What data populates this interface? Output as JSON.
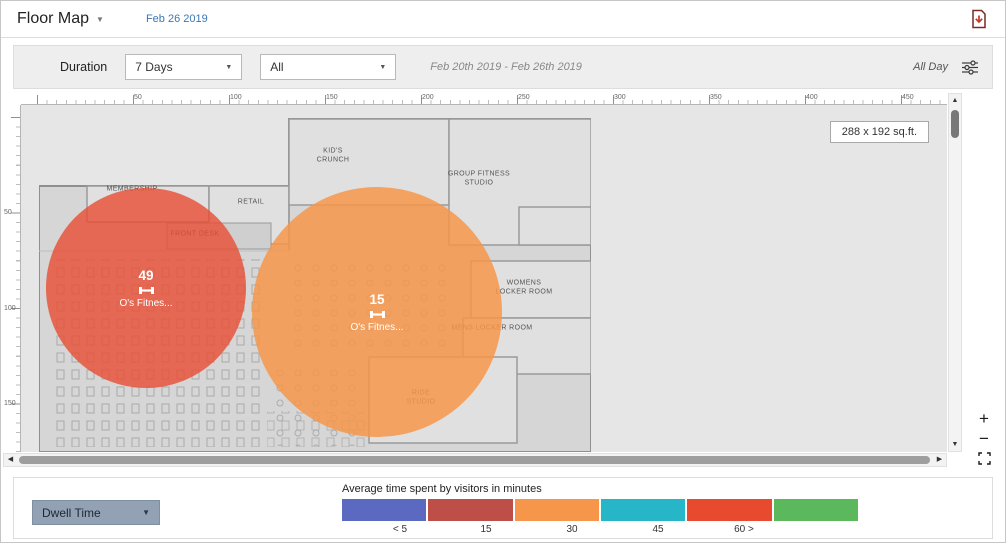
{
  "header": {
    "title": "Floor Map",
    "date": "Feb 26 2019"
  },
  "toolbar": {
    "duration_label": "Duration",
    "duration_value": "7 Days",
    "zone_value": "All",
    "date_range": "Feb 20th 2019 - Feb 26th 2019",
    "time_filter": "All Day"
  },
  "map": {
    "size_label": "288 x 192 sq.ft.",
    "ruler_x": [
      "50",
      "100",
      "150",
      "200",
      "250",
      "300",
      "350",
      "400",
      "450"
    ],
    "ruler_y": [
      "50",
      "100",
      "150"
    ],
    "rooms": [
      "MEMBERSHIP",
      "RETAIL",
      "FRONT DESK",
      "KID'S\nCRUNCH",
      "GROUP FITNESS\nSTUDIO",
      "WOMENS LOCKER ROOM",
      "MENS LOCKER ROOM",
      "RIDE\nSTUDIO"
    ],
    "bubbles": [
      {
        "value": "49",
        "label": "O's Fitnes...",
        "color": "rgba(231,76,50,0.8)"
      },
      {
        "value": "15",
        "label": "O's Fitnes...",
        "color": "rgba(246,150,74,0.85)"
      }
    ],
    "zoom_in": "+",
    "zoom_out": "−"
  },
  "legend": {
    "selector": "Dwell Time",
    "title": "Average time spent by visitors in minutes",
    "colors": [
      "#5b6ac0",
      "#bd4f48",
      "#f6964a",
      "#27b6c7",
      "#e84a30",
      "#5cb85c"
    ],
    "labels": [
      "< 5",
      "15",
      "30",
      "45",
      "60 >"
    ]
  }
}
